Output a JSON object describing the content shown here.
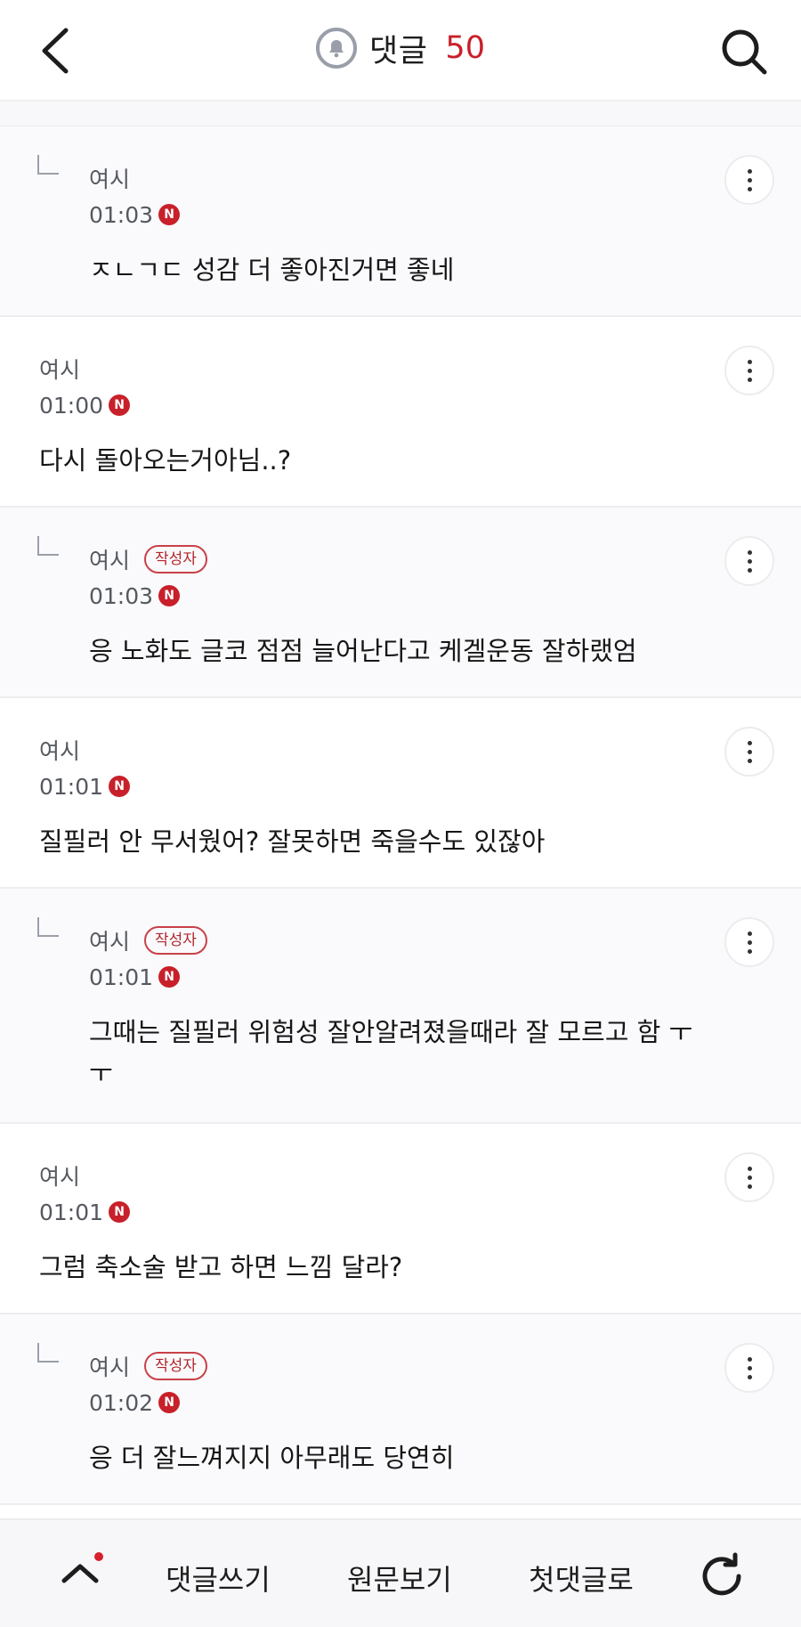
{
  "header": {
    "title": "댓글",
    "count": "50"
  },
  "comments": [
    {
      "reply": true,
      "nick": "여시",
      "author_badge": "",
      "time": "01:03",
      "text": "ㅈㄴㄱㄷ 성감 더 좋아진거면 좋네"
    },
    {
      "reply": false,
      "nick": "여시",
      "author_badge": "",
      "time": "01:00",
      "text": "다시 돌아오는거아님..?"
    },
    {
      "reply": true,
      "nick": "여시",
      "author_badge": "작성자",
      "time": "01:03",
      "text": "응 노화도 글코 점점 늘어난다고 케겔운동 잘하랬엄"
    },
    {
      "reply": false,
      "nick": "여시",
      "author_badge": "",
      "time": "01:01",
      "text": "질필러 안 무서웠어? 잘못하면 죽을수도 있잖아"
    },
    {
      "reply": true,
      "nick": "여시",
      "author_badge": "작성자",
      "time": "01:01",
      "text_line1": "그때는 질필러 위험성 잘안알려졌을때라 잘 모르고 함 ㅜ",
      "text_line2": "ㅜ"
    },
    {
      "reply": false,
      "nick": "여시",
      "author_badge": "",
      "time": "01:01",
      "text": "그럼 축소술 받고 하면 느낌 달라?"
    },
    {
      "reply": true,
      "nick": "여시",
      "author_badge": "작성자",
      "time": "01:02",
      "text": "응 더 잘느껴지지 아무래도 당연히"
    }
  ],
  "bottom": {
    "write": "댓글쓰기",
    "original": "원문보기",
    "first": "첫댓글로"
  },
  "badge_letter": "N",
  "colors": {
    "accent": "#c8202a"
  }
}
